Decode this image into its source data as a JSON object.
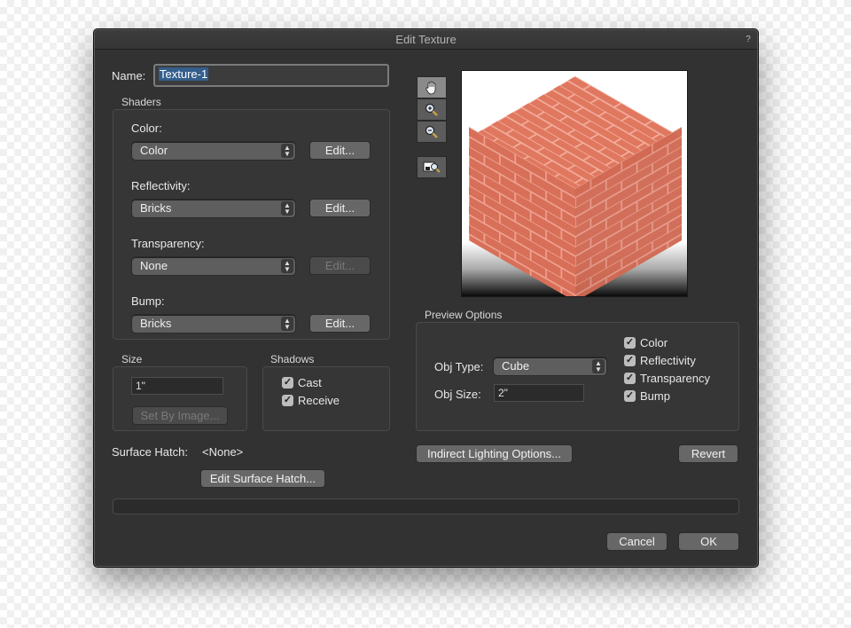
{
  "window": {
    "title": "Edit Texture",
    "help_label": "?"
  },
  "name": {
    "label": "Name:",
    "value": "Texture-1"
  },
  "shaders": {
    "group_label": "Shaders",
    "color": {
      "label": "Color:",
      "value": "Color",
      "edit_label": "Edit..."
    },
    "reflectivity": {
      "label": "Reflectivity:",
      "value": "Bricks",
      "edit_label": "Edit..."
    },
    "transparency": {
      "label": "Transparency:",
      "value": "None",
      "edit_label": "Edit..."
    },
    "bump": {
      "label": "Bump:",
      "value": "Bricks",
      "edit_label": "Edit..."
    }
  },
  "size": {
    "group_label": "Size",
    "value": "1\"",
    "set_by_image_label": "Set By Image..."
  },
  "shadows": {
    "group_label": "Shadows",
    "cast_label": "Cast",
    "cast_checked": true,
    "receive_label": "Receive",
    "receive_checked": true
  },
  "surface_hatch": {
    "label": "Surface Hatch:",
    "value": "<None>",
    "edit_label": "Edit Surface Hatch..."
  },
  "tools": [
    "hand-icon",
    "zoom-in-icon",
    "zoom-out-icon",
    "fit-view-icon"
  ],
  "preview_options": {
    "group_label": "Preview Options",
    "obj_type": {
      "label": "Obj Type:",
      "value": "Cube"
    },
    "obj_size": {
      "label": "Obj Size:",
      "value": "2\""
    },
    "checkboxes": [
      {
        "label": "Color",
        "checked": true
      },
      {
        "label": "Reflectivity",
        "checked": true
      },
      {
        "label": "Transparency",
        "checked": true
      },
      {
        "label": "Bump",
        "checked": true
      }
    ]
  },
  "indirect_lighting_label": "Indirect Lighting Options...",
  "revert_label": "Revert",
  "cancel_label": "Cancel",
  "ok_label": "OK",
  "colors": {
    "brick": "#d9705a",
    "brick_mortar": "#efa896",
    "dialog_bg": "#323232"
  }
}
